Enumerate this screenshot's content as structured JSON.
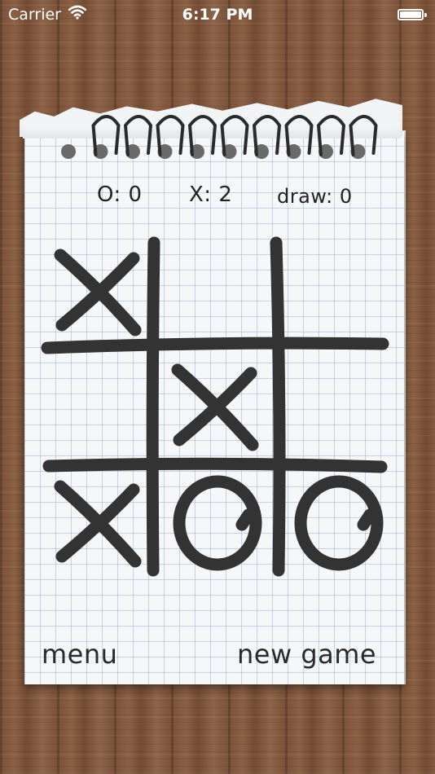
{
  "status_bar": {
    "carrier": "Carrier",
    "time": "6:17 PM",
    "battery_level": 1.0
  },
  "score": {
    "o_label": "O:",
    "o_value": "0",
    "x_label": "X:",
    "x_value": "2",
    "draw_label": "draw:",
    "draw_value": "0"
  },
  "board": {
    "cells": [
      "X",
      "",
      "",
      "",
      "X",
      "",
      "X",
      "O",
      "O"
    ]
  },
  "buttons": {
    "menu": "menu",
    "new_game": "new game"
  },
  "colors": {
    "ink": "#333333",
    "paper": "#f6f7f9",
    "grid_line": "#7896c8",
    "wood": "#7d5539"
  },
  "icons": {
    "wifi": "wifi-icon",
    "battery": "battery-icon"
  }
}
